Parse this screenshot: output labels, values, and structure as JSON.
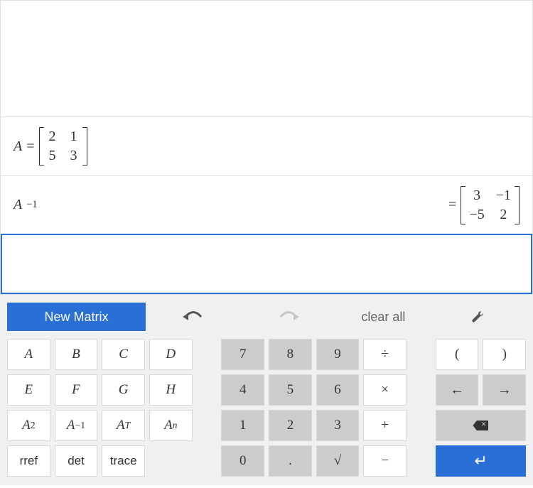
{
  "display": {
    "matrix_def": {
      "lhs_var": "A",
      "eq": "=",
      "matrix": {
        "r0c0": "2",
        "r0c1": "1",
        "r1c0": "5",
        "r1c1": "3"
      }
    },
    "result": {
      "lhs_var": "A",
      "lhs_exp": "−1",
      "eq": "=",
      "matrix": {
        "r0c0": "3",
        "r0c1": "−1",
        "r1c0": "−5",
        "r1c1": "2"
      }
    }
  },
  "toolbar": {
    "new_matrix": "New Matrix",
    "clear_all": "clear all"
  },
  "keys": {
    "letters": {
      "A": "A",
      "B": "B",
      "C": "C",
      "D": "D",
      "E": "E",
      "F": "F",
      "G": "G",
      "H": "H"
    },
    "ops": {
      "Asq_base": "A",
      "Asq_exp": "2",
      "Ainv_base": "A",
      "Ainv_exp": "−1",
      "AT_base": "A",
      "AT_exp": "T",
      "An_base": "A",
      "An_exp": "n",
      "rref": "rref",
      "det": "det",
      "trace": "trace"
    },
    "digits": {
      "7": "7",
      "8": "8",
      "9": "9",
      "4": "4",
      "5": "5",
      "6": "6",
      "1": "1",
      "2": "2",
      "3": "3",
      "0": "0",
      "dot": ".",
      "sqrt": "√"
    },
    "arith": {
      "div": "÷",
      "mul": "×",
      "add": "+",
      "sub": "−"
    },
    "paren": {
      "open": "(",
      "close": ")"
    },
    "nav": {
      "left": "←",
      "right": "→",
      "enter": "↵"
    }
  }
}
